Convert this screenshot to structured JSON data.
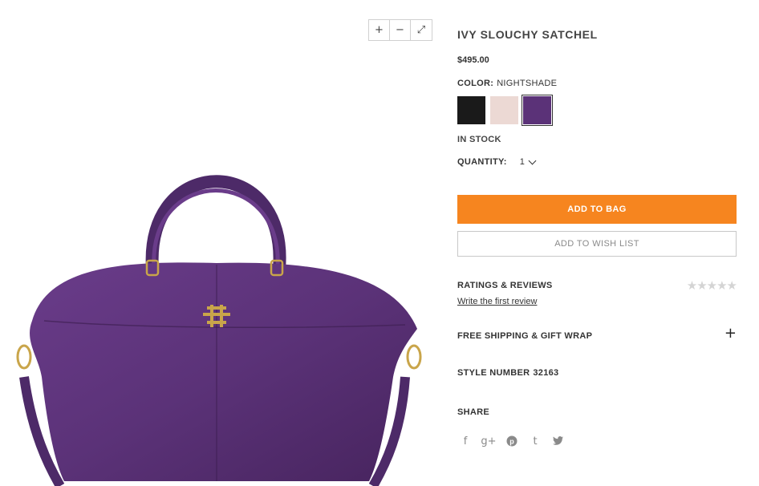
{
  "product": {
    "title": "IVY SLOUCHY SATCHEL",
    "price": "$495.00",
    "color_label": "COLOR:",
    "color_value": "NIGHTSHADE",
    "swatches": [
      {
        "name": "black",
        "color": "#1a1a1a",
        "selected": false
      },
      {
        "name": "blush",
        "color": "#ecd9d4",
        "selected": false
      },
      {
        "name": "nightshade",
        "color": "#5b3278",
        "selected": true
      }
    ],
    "stock": "IN STOCK",
    "quantity_label": "QUANTITY:",
    "quantity_value": "1"
  },
  "zoom": {
    "zoom_in": "+",
    "zoom_out": "−",
    "fullscreen": "⤢"
  },
  "actions": {
    "add_to_bag": "ADD TO BAG",
    "add_to_wishlist": "ADD TO WISH LIST"
  },
  "reviews": {
    "title": "RATINGS & REVIEWS",
    "stars": "★★★★★",
    "write_link": "Write the first review"
  },
  "shipping": {
    "title": "FREE SHIPPING & GIFT WRAP",
    "expand": "+"
  },
  "style": {
    "label": "STYLE NUMBER",
    "value": "32163"
  },
  "share": {
    "title": "SHARE",
    "icons": [
      {
        "name": "facebook-icon",
        "glyph": "f"
      },
      {
        "name": "google-plus-icon",
        "glyph": "g+"
      },
      {
        "name": "pinterest-icon",
        "glyph": "℗"
      },
      {
        "name": "tumblr-icon",
        "glyph": "t"
      },
      {
        "name": "twitter-icon",
        "glyph": "🐦"
      }
    ]
  },
  "colors": {
    "accent": "#f6851f",
    "bag": "#5b3278",
    "hardware": "#c9a54a"
  }
}
